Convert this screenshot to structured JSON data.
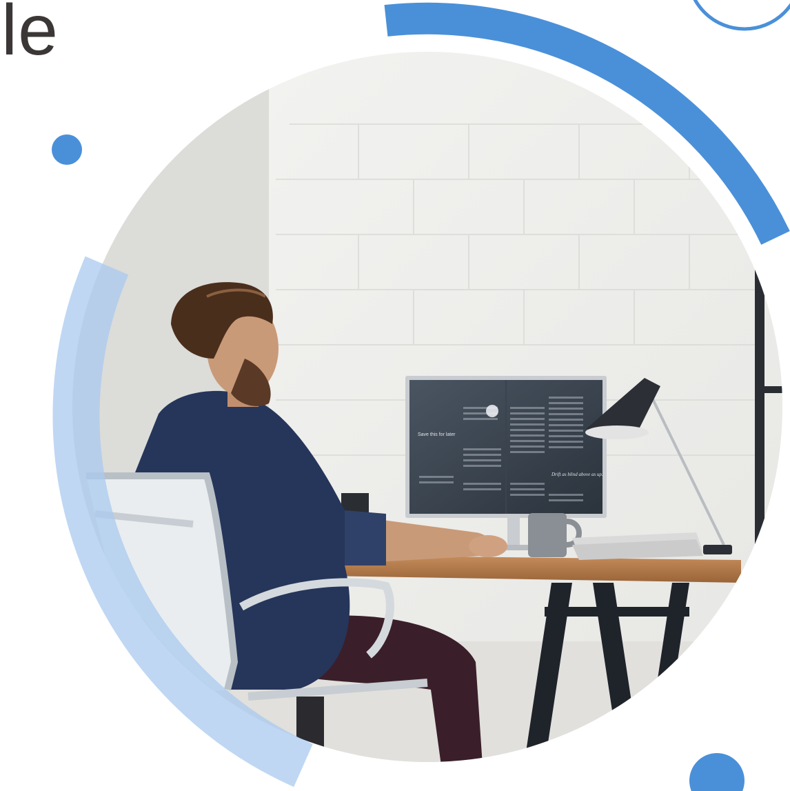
{
  "headline_fragment": "le",
  "monitor": {
    "left_page_title": "Save this for later",
    "right_page_pullquote": "Drift as blind above as up."
  },
  "colors": {
    "accent_blue": "#4a90d9",
    "light_blue": "#a9c9ef",
    "text_dark": "#3b3737",
    "wall": "#efefed",
    "desk_wood": "#b47a4a",
    "shirt_navy": "#26355a"
  },
  "icons": {
    "decor_dot_left": "circle-dot",
    "decor_dot_bottom_right": "circle-dot",
    "decor_ring_top_right": "ring-outline"
  }
}
